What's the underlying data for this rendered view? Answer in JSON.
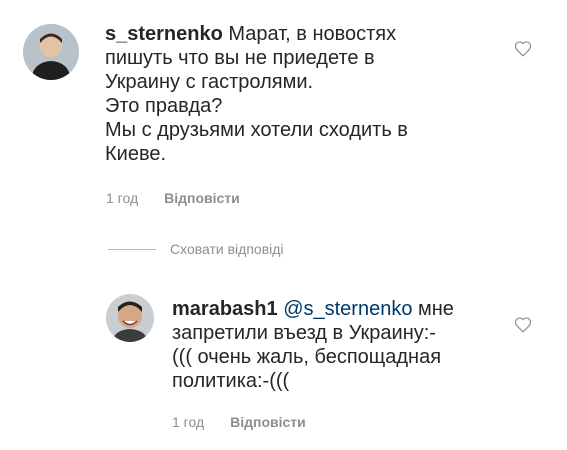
{
  "comments": [
    {
      "username": "s_sternenko",
      "text": " Марат, в новостях\nпишуть что вы не приедете в\nУкраину с гастролями.\nЭто правда?\nМы с друзьями хотели сходить в\nКиеве.",
      "time": "1 год",
      "reply_label": "Відповісти"
    }
  ],
  "hide_replies_label": "Сховати відповіді",
  "replies": [
    {
      "username": "marabash1",
      "mention": "@s_sternenko",
      "text": " мне\nзапретили въезд в Украину:-\n((( очень жаль, беспощадная\nполитика:-(((",
      "time": "1 год",
      "reply_label": "Відповісти"
    }
  ],
  "icons": {
    "like": "heart-icon"
  },
  "colors": {
    "text": "#262626",
    "muted": "#8e8e8e",
    "mention": "#00376b"
  }
}
